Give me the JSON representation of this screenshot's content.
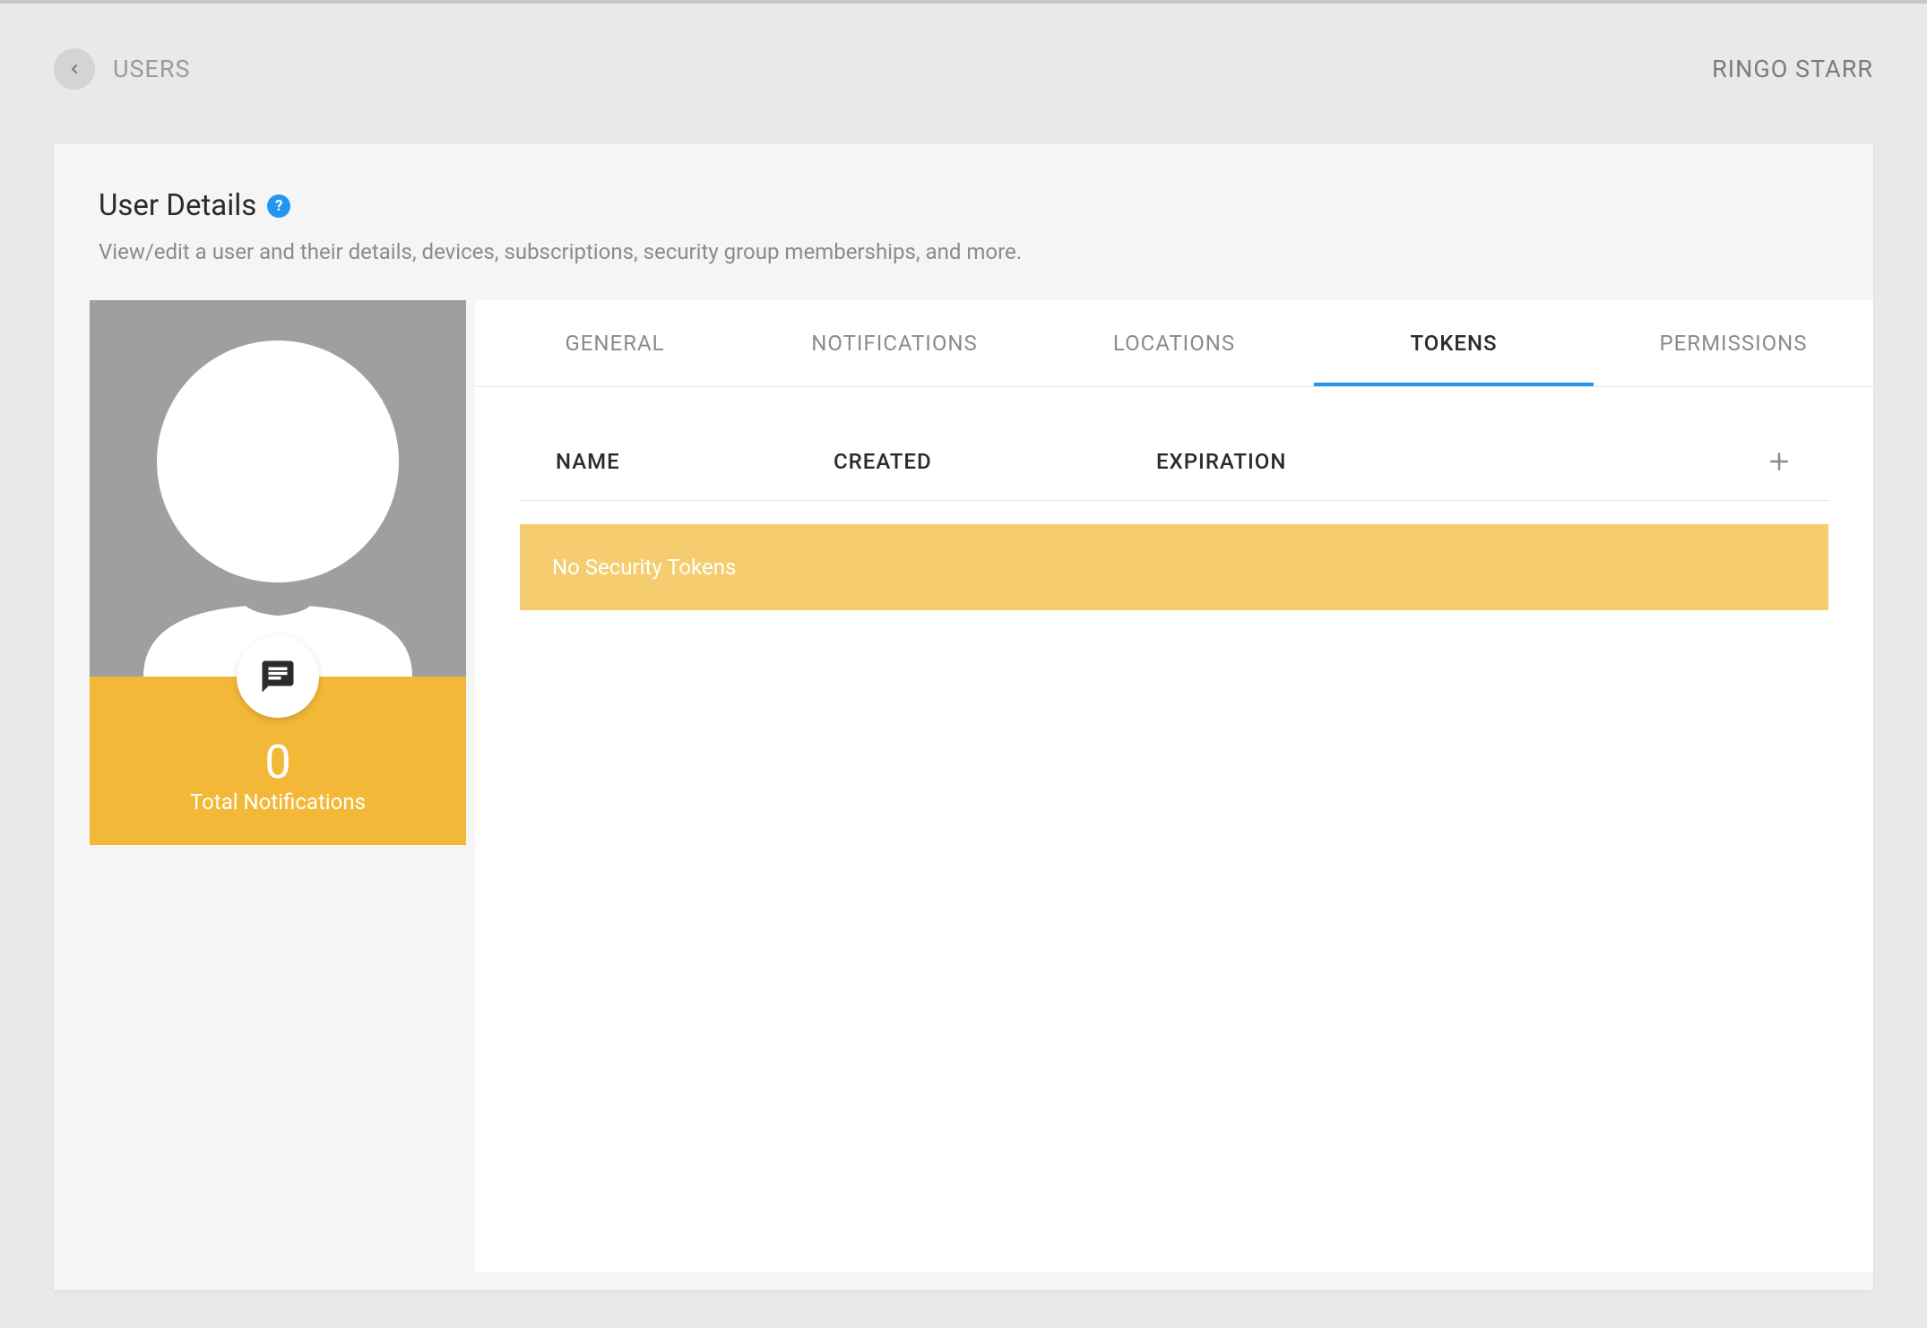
{
  "breadcrumb": {
    "label": "USERS"
  },
  "header": {
    "user_name": "RINGO STARR"
  },
  "panel": {
    "title": "User Details",
    "subtitle": "View/edit a user and their details, devices, subscriptions, security group memberships, and more."
  },
  "sidebar_card": {
    "notification_count": "0",
    "notification_label": "Total Notifications"
  },
  "tabs": {
    "items": [
      {
        "label": "GENERAL",
        "active": false
      },
      {
        "label": "NOTIFICATIONS",
        "active": false
      },
      {
        "label": "LOCATIONS",
        "active": false
      },
      {
        "label": "TOKENS",
        "active": true
      },
      {
        "label": "PERMISSIONS",
        "active": false
      }
    ]
  },
  "tokens_table": {
    "columns": {
      "name": "NAME",
      "created": "CREATED",
      "expiration": "EXPIRATION"
    },
    "empty_message": "No Security Tokens"
  },
  "colors": {
    "accent_blue": "#2196f3",
    "accent_yellow": "#f3b838",
    "empty_row_yellow": "#f5cd6e",
    "page_bg": "#e9e9e9",
    "panel_bg": "#f5f5f5"
  }
}
